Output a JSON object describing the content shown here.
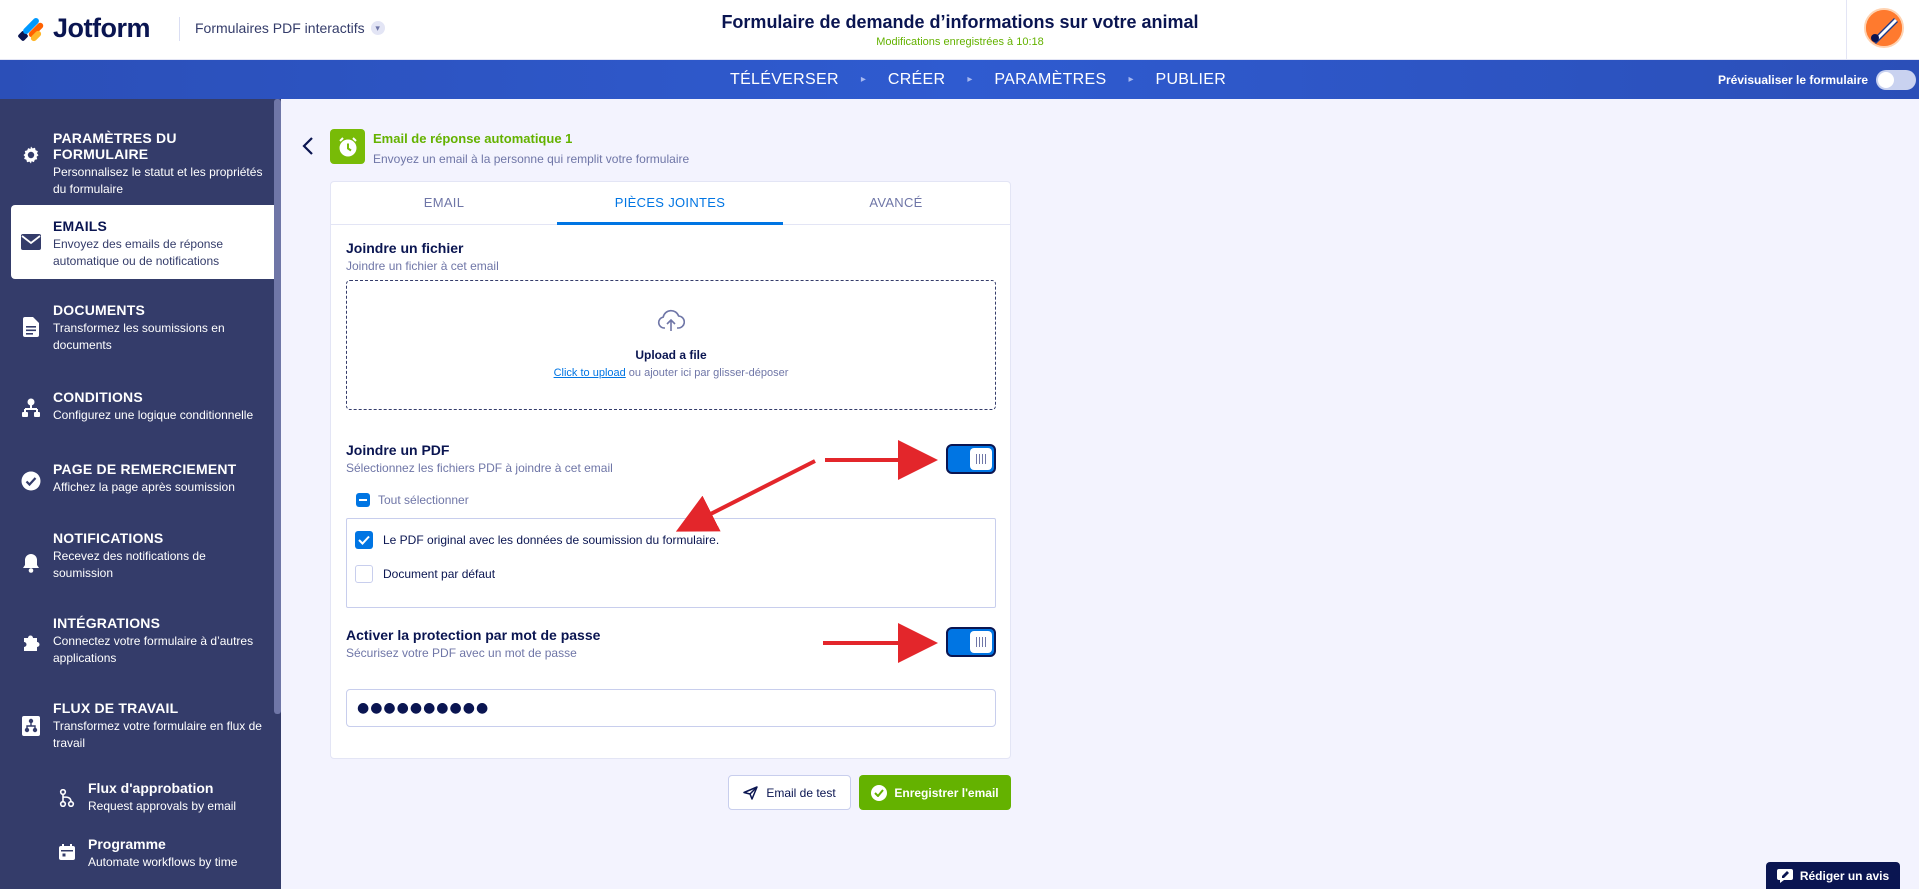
{
  "header": {
    "logo_text": "Jotform",
    "form_type": "Formulaires PDF interactifs",
    "form_title": "Formulaire de demande d’informations sur votre animal",
    "saved_status": "Modifications enregistrées à 10:18"
  },
  "nav": {
    "items": [
      "TÉLÉVERSER",
      "CRÉER",
      "PARAMÈTRES",
      "PUBLIER"
    ],
    "preview_label": "Prévisualiser le formulaire"
  },
  "sidebar": {
    "items": [
      {
        "title": "PARAMÈTRES DU FORMULAIRE",
        "desc": "Personnalisez le statut et les propriétés du formulaire"
      },
      {
        "title": "EMAILS",
        "desc": "Envoyez des emails de réponse automatique ou de notifications"
      },
      {
        "title": "DOCUMENTS",
        "desc": "Transformez les soumissions en documents"
      },
      {
        "title": "CONDITIONS",
        "desc": "Configurez une logique conditionnelle"
      },
      {
        "title": "PAGE DE REMERCIEMENT",
        "desc": "Affichez la page après soumission"
      },
      {
        "title": "NOTIFICATIONS",
        "desc": "Recevez des notifications de soumission"
      },
      {
        "title": "INTÉGRATIONS",
        "desc": "Connectez votre formulaire à d’autres applications"
      },
      {
        "title": "FLUX DE TRAVAIL",
        "desc": "Transformez votre formulaire en flux de travail"
      }
    ],
    "sub_items": [
      {
        "title": "Flux d'approbation",
        "desc": "Request approvals by email"
      },
      {
        "title": "Programme",
        "desc": "Automate workflows by time"
      }
    ]
  },
  "autoresponder": {
    "title": "Email de réponse automatique 1",
    "subtitle": "Envoyez un email à la personne qui remplit votre formulaire"
  },
  "tabs": [
    "EMAIL",
    "PIÈCES JOINTES",
    "AVANCÉ"
  ],
  "attach_file": {
    "title": "Joindre un fichier",
    "subtitle": "Joindre un fichier à cet email",
    "upload_title": "Upload a file",
    "upload_link": "Click to upload",
    "upload_rest": " ou ajouter ici par glisser-déposer"
  },
  "attach_pdf": {
    "title": "Joindre un PDF",
    "subtitle": "Sélectionnez les fichiers PDF à joindre à cet email",
    "select_all": "Tout sélectionner",
    "options": [
      {
        "label": "Le PDF original avec les données de soumission du formulaire.",
        "checked": true
      },
      {
        "label": "Document par défaut",
        "checked": false
      }
    ]
  },
  "password": {
    "title": "Activer la protection par mot de passe",
    "subtitle": "Sécurisez votre PDF avec un mot de passe",
    "value": "●●●●●●●●●●"
  },
  "buttons": {
    "test": "Email de test",
    "save": "Enregistrer l'email",
    "review": "Rédiger un avis"
  },
  "colors": {
    "accent": "#0075e3",
    "success": "#64b200",
    "sidebar": "#343c6a",
    "annotation_arrow": "#e3262b"
  }
}
